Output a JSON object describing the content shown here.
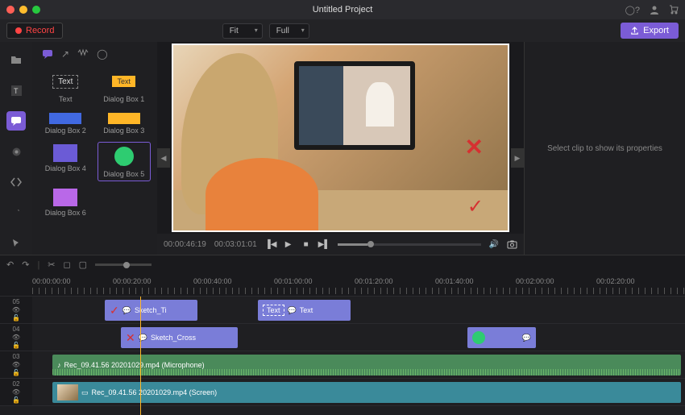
{
  "title": "Untitled Project",
  "toolbar": {
    "record": "Record",
    "fit": "Fit",
    "full": "Full",
    "export": "Export"
  },
  "titlebar_icons": {
    "help": "?",
    "user": "user",
    "cart": "cart"
  },
  "panel": {
    "items": [
      {
        "label": "Text"
      },
      {
        "label": "Dialog Box 1",
        "inner": "Text"
      },
      {
        "label": "Dialog Box 2"
      },
      {
        "label": "Dialog Box 3"
      },
      {
        "label": "Dialog Box 4"
      },
      {
        "label": "Dialog Box 5"
      },
      {
        "label": "Dialog Box 6"
      }
    ]
  },
  "preview": {
    "time_current": "00:00:46:19",
    "time_total": "00:03:01:01"
  },
  "props": {
    "empty": "Select clip to show its properties"
  },
  "ruler": [
    "00:00:00:00",
    "00:00:20:00",
    "00:00:40:00",
    "00:01:00:00",
    "00:01:20:00",
    "00:01:40:00",
    "00:02:00:00",
    "00:02:20:00"
  ],
  "tracks": {
    "t05": {
      "num": "05",
      "clips": [
        {
          "label": "Sketch_Ti"
        },
        {
          "label": "Text",
          "inner": "Text"
        }
      ]
    },
    "t04": {
      "num": "04",
      "clips": [
        {
          "label": "Sketch_Cross"
        }
      ]
    },
    "t03": {
      "num": "03",
      "clips": [
        {
          "label": "Rec_09.41.56 20201029.mp4 (Microphone)"
        }
      ]
    },
    "t02": {
      "num": "02",
      "clips": [
        {
          "label": "Rec_09.41.56 20201029.mp4 (Screen)"
        }
      ]
    }
  }
}
